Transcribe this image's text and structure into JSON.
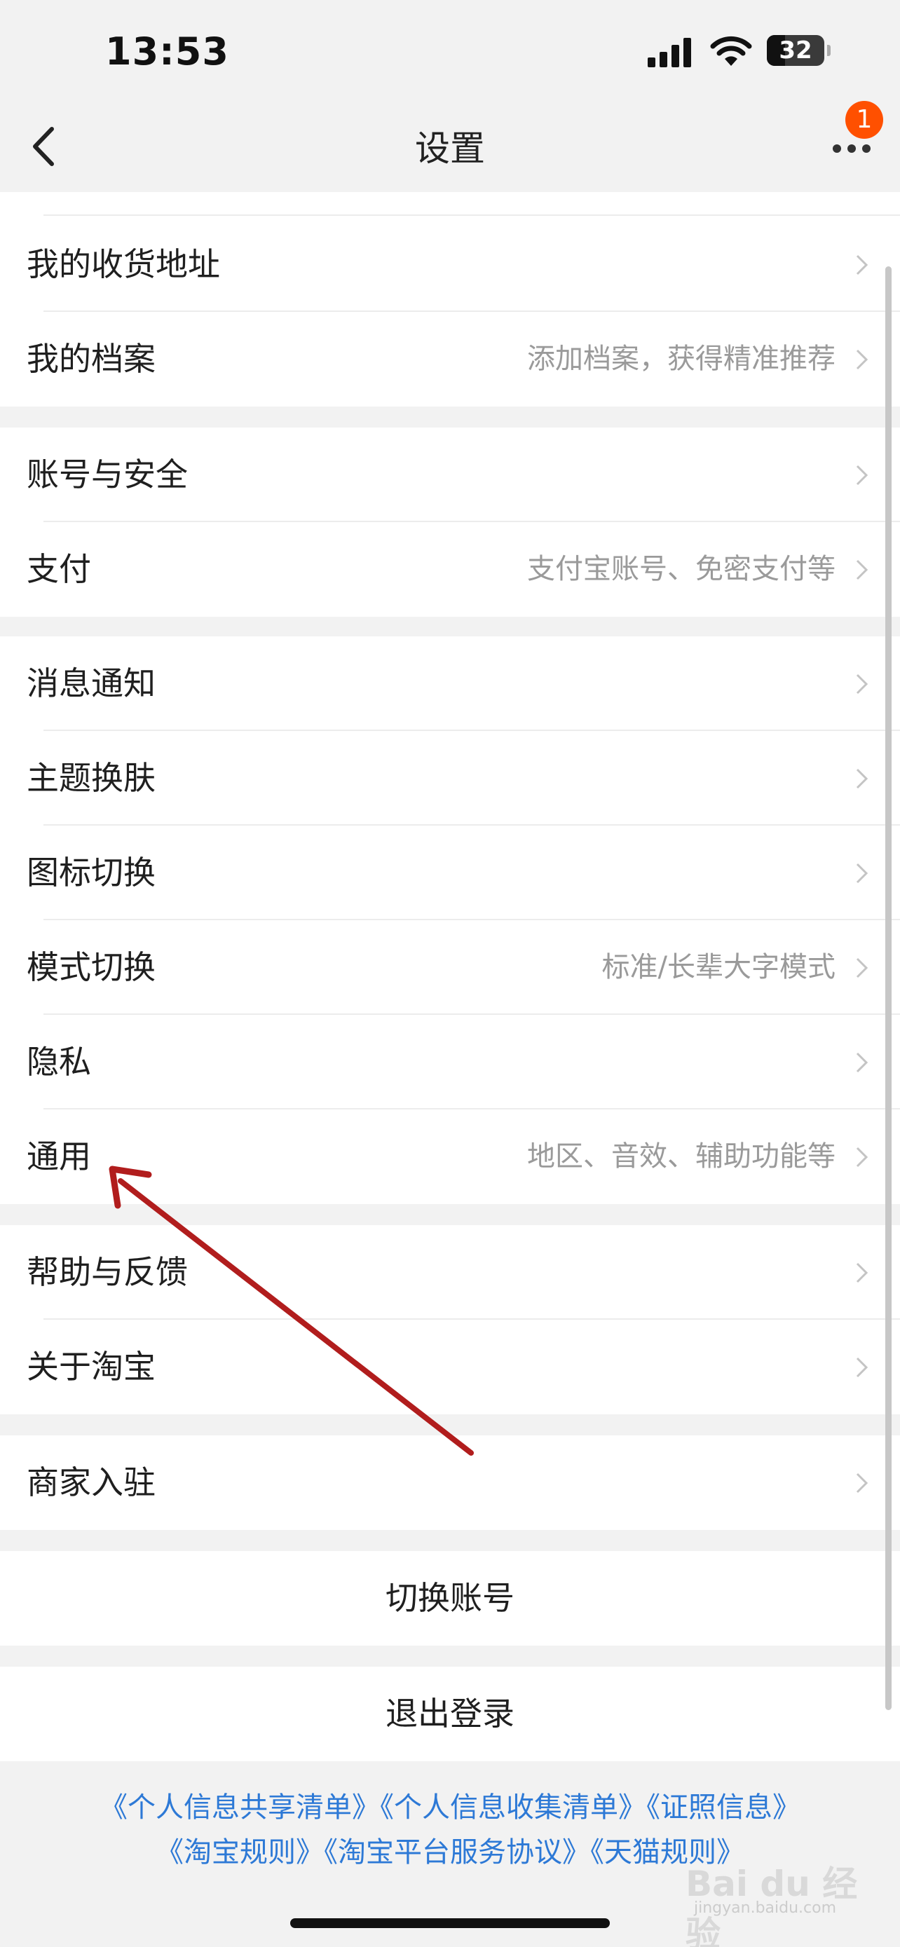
{
  "status_bar": {
    "time": "13:53",
    "battery": "32",
    "battery_level": 0.32
  },
  "nav": {
    "title": "设置",
    "badge": "1"
  },
  "groups": [
    {
      "rows": [
        {
          "label": "我的收货地址",
          "hint": ""
        },
        {
          "label": "我的档案",
          "hint": "添加档案，获得精准推荐"
        }
      ]
    },
    {
      "rows": [
        {
          "label": "账号与安全",
          "hint": ""
        },
        {
          "label": "支付",
          "hint": "支付宝账号、免密支付等"
        }
      ]
    },
    {
      "rows": [
        {
          "label": "消息通知",
          "hint": ""
        },
        {
          "label": "主题换肤",
          "hint": ""
        },
        {
          "label": "图标切换",
          "hint": ""
        },
        {
          "label": "模式切换",
          "hint": "标准/长辈大字模式"
        },
        {
          "label": "隐私",
          "hint": ""
        },
        {
          "label": "通用",
          "hint": "地区、音效、辅助功能等"
        }
      ]
    },
    {
      "rows": [
        {
          "label": "帮助与反馈",
          "hint": ""
        },
        {
          "label": "关于淘宝",
          "hint": ""
        }
      ]
    },
    {
      "rows": [
        {
          "label": "商家入驻",
          "hint": ""
        }
      ]
    }
  ],
  "actions": {
    "switch_account": "切换账号",
    "logout": "退出登录"
  },
  "links": {
    "line1": "《个人信息共享清单》《个人信息收集清单》《证照信息》",
    "line2": "《淘宝规则》《淘宝平台服务协议》《天猫规则》"
  },
  "watermark": {
    "text": "Bai du 经验",
    "sub": "jingyan.baidu.com"
  },
  "colors": {
    "background": "#f2f2f2",
    "link": "#2d79d6",
    "badge": "#ff5000",
    "annotation_arrow": "#b11d1d"
  }
}
